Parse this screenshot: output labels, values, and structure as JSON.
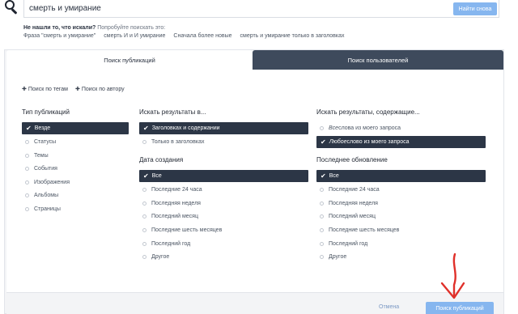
{
  "search": {
    "query": "смерть и умирание",
    "again_button": "Найти снова"
  },
  "hint": {
    "bold": "Не нашли то, что искали?",
    "text": " Попробуйте поискать это:",
    "suggestions": [
      "Фраза \"смерть и умирание\"",
      "смерть И и И умирание",
      "Сначала более новые",
      "смерть и умирание только в заголовках"
    ]
  },
  "tabs": {
    "publications": "Поиск публикаций",
    "users": "Поиск пользователей"
  },
  "add_links": {
    "tags": "Поиск по тегам",
    "author": "Поиск по автору"
  },
  "type": {
    "title": "Тип публикаций",
    "options": [
      "Везде",
      "Статусы",
      "Темы",
      "События",
      "Изображения",
      "Альбомы",
      "Страницы"
    ],
    "selected": 0
  },
  "search_in": {
    "title": "Искать результаты в...",
    "options": [
      "Заголовках и содержании",
      "Только в заголовках"
    ],
    "selected": 0
  },
  "created": {
    "title": "Дата создания",
    "options": [
      "Все",
      "Последние 24 часа",
      "Последняя неделя",
      "Последний месяц",
      "Последние шесть месяцев",
      "Последний год",
      "Другое"
    ],
    "selected": 0
  },
  "containing": {
    "title": "Искать результаты, содержащие...",
    "options": [
      {
        "em": "Все",
        "rest": " слова из моего запроса"
      },
      {
        "em": "Любое",
        "rest": " слово из моего запроса"
      }
    ],
    "selected": 1
  },
  "updated": {
    "title": "Последнее обновление",
    "options": [
      "Все",
      "Последние 24 часа",
      "Последняя неделя",
      "Последний месяц",
      "Последние шесть месяцев",
      "Последний год",
      "Другое"
    ],
    "selected": 0
  },
  "footer": {
    "cancel": "Отмена",
    "submit": "Поиск публикаций"
  },
  "colors": {
    "selected_bg": "#2c3646",
    "accent_button": "#86b6ef",
    "tab_dark": "#3e4a5c",
    "annotation_arrow": "#e0302a"
  }
}
